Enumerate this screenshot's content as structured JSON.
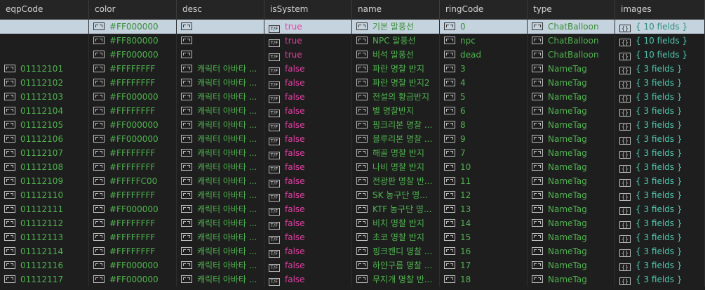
{
  "columns": [
    "eqpCode",
    "color",
    "desc",
    "isSystem",
    "name",
    "ringCode",
    "type",
    "images"
  ],
  "icons": {
    "string": "string-icon",
    "bool_text": "T/F",
    "object_text": "{}"
  },
  "colors": {
    "string_value": "#4fb34f",
    "bool_value": "#e23fa2",
    "object_value": "#4ec9b0",
    "selected_row": "#c5d3df"
  },
  "rows": [
    {
      "eqpCode": "",
      "color": "#FF000000",
      "desc": "",
      "isSystem": "true",
      "name": "기본 말풍선",
      "ringCode": "0",
      "type": "ChatBalloon",
      "images": "{ 10 fields }",
      "selected": true
    },
    {
      "eqpCode": "",
      "color": "#FF800000",
      "desc": "",
      "isSystem": "true",
      "name": "NPC 말풍선",
      "ringCode": "npc",
      "type": "ChatBalloon",
      "images": "{ 10 fields }"
    },
    {
      "eqpCode": "",
      "color": "#FF000000",
      "desc": "",
      "isSystem": "true",
      "name": "비석 말풍선",
      "ringCode": "dead",
      "type": "ChatBalloon",
      "images": "{ 10 fields }"
    },
    {
      "eqpCode": "01112101",
      "color": "#FFFFFFFF",
      "desc": "캐릭터 아바타 ...",
      "isSystem": "false",
      "name": "파란 명찰 반지",
      "ringCode": "3",
      "type": "NameTag",
      "images": "{ 3 fields }"
    },
    {
      "eqpCode": "01112102",
      "color": "#FFFFFFFF",
      "desc": "캐릭터 아바타 ...",
      "isSystem": "false",
      "name": "파란 명찰 반지2",
      "ringCode": "4",
      "type": "NameTag",
      "images": "{ 3 fields }"
    },
    {
      "eqpCode": "01112103",
      "color": "#FF000000",
      "desc": "캐릭터 아바타 ...",
      "isSystem": "false",
      "name": "전설의 황금반지",
      "ringCode": "5",
      "type": "NameTag",
      "images": "{ 3 fields }"
    },
    {
      "eqpCode": "01112104",
      "color": "#FFFFFFFF",
      "desc": "캐릭터 아바타 ...",
      "isSystem": "false",
      "name": "별 명찰반지",
      "ringCode": "6",
      "type": "NameTag",
      "images": "{ 3 fields }"
    },
    {
      "eqpCode": "01112105",
      "color": "#FF000000",
      "desc": "캐릭터 아바타 ...",
      "isSystem": "false",
      "name": "핑크리본 명찰 ...",
      "ringCode": "8",
      "type": "NameTag",
      "images": "{ 3 fields }"
    },
    {
      "eqpCode": "01112106",
      "color": "#FF000000",
      "desc": "캐릭터 아바타 ...",
      "isSystem": "false",
      "name": "블루리본 명찰 ...",
      "ringCode": "9",
      "type": "NameTag",
      "images": "{ 3 fields }"
    },
    {
      "eqpCode": "01112107",
      "color": "#FFFFFFFF",
      "desc": "캐릭터 아바타 ...",
      "isSystem": "false",
      "name": "해골 명찰 반지",
      "ringCode": "7",
      "type": "NameTag",
      "images": "{ 3 fields }"
    },
    {
      "eqpCode": "01112108",
      "color": "#FFFFFFFF",
      "desc": "캐릭터 아바타 ...",
      "isSystem": "false",
      "name": "나비 명찰 반지",
      "ringCode": "10",
      "type": "NameTag",
      "images": "{ 3 fields }"
    },
    {
      "eqpCode": "01112109",
      "color": "#FFFFFC00",
      "desc": "캐릭터 아바타 ...",
      "isSystem": "false",
      "name": "전광판 명찰 반...",
      "ringCode": "11",
      "type": "NameTag",
      "images": "{ 3 fields }"
    },
    {
      "eqpCode": "01112110",
      "color": "#FFFFFFFF",
      "desc": "캐릭터 아바타 ...",
      "isSystem": "false",
      "name": "SK 농구단 명...",
      "ringCode": "12",
      "type": "NameTag",
      "images": "{ 3 fields }"
    },
    {
      "eqpCode": "01112111",
      "color": "#FF000000",
      "desc": "캐릭터 아바타 ...",
      "isSystem": "false",
      "name": "KTF 농구단 명...",
      "ringCode": "13",
      "type": "NameTag",
      "images": "{ 3 fields }"
    },
    {
      "eqpCode": "01112112",
      "color": "#FFFFFFFF",
      "desc": "캐릭터 아바타 ...",
      "isSystem": "false",
      "name": "비치 명찰 반지",
      "ringCode": "14",
      "type": "NameTag",
      "images": "{ 3 fields }"
    },
    {
      "eqpCode": "01112113",
      "color": "#FFFFFFFF",
      "desc": "캐릭터 아바타 ...",
      "isSystem": "false",
      "name": "초코 명찰 반지",
      "ringCode": "15",
      "type": "NameTag",
      "images": "{ 3 fields }"
    },
    {
      "eqpCode": "01112114",
      "color": "#FFFFFFFF",
      "desc": "캐릭터 아바타 ...",
      "isSystem": "false",
      "name": "핑크캔디 명찰 ...",
      "ringCode": "16",
      "type": "NameTag",
      "images": "{ 3 fields }"
    },
    {
      "eqpCode": "01112116",
      "color": "#FF000000",
      "desc": "캐릭터 아바타 ...",
      "isSystem": "false",
      "name": "하얀구름 명찰 ...",
      "ringCode": "17",
      "type": "NameTag",
      "images": "{ 3 fields }"
    },
    {
      "eqpCode": "01112117",
      "color": "#FF000000",
      "desc": "캐릭터 아바타 ...",
      "isSystem": "false",
      "name": "무지개 명찰 반...",
      "ringCode": "18",
      "type": "NameTag",
      "images": "{ 3 fields }"
    }
  ]
}
